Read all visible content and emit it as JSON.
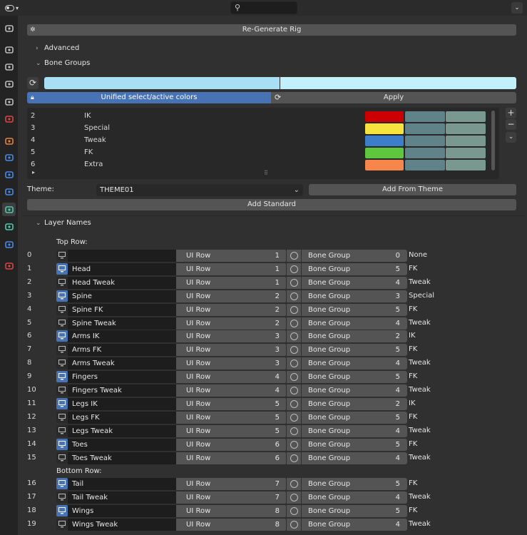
{
  "topbar": {
    "search_placeholder": ""
  },
  "panel": {
    "regenerate_label": "Re-Generate Rig",
    "advanced_label": "Advanced",
    "bone_groups_label": "Bone Groups",
    "unified_label": "Unified select/active colors",
    "apply_label": "Apply",
    "theme_label": "Theme:",
    "theme_value": "THEME01",
    "add_from_theme_label": "Add From Theme",
    "add_standard_label": "Add Standard",
    "layer_names_label": "Layer Names",
    "top_row_label": "Top Row:",
    "bottom_row_label": "Bottom Row:",
    "ui_row_label": "UI Row",
    "bone_group_label": "Bone Group",
    "colors": {
      "accent": "#4772b3",
      "active_swatch": "#a8dff4",
      "select_swatch": "#c2f0fa"
    }
  },
  "bone_groups": [
    {
      "num": "2",
      "name": "IK",
      "color": "#cc0000"
    },
    {
      "num": "3",
      "name": "Special",
      "color": "#f7e33d"
    },
    {
      "num": "4",
      "name": "Tweak",
      "color": "#3d7ecb"
    },
    {
      "num": "5",
      "name": "FK",
      "color": "#5fc73d"
    },
    {
      "num": "6",
      "name": "Extra",
      "color": "#f7864d"
    }
  ],
  "layers": [
    {
      "idx": "0",
      "name": "",
      "on": false,
      "row": "1",
      "group": "0",
      "gname": "None"
    },
    {
      "idx": "1",
      "name": " Head",
      "on": true,
      "row": "1",
      "group": "5",
      "gname": "FK"
    },
    {
      "idx": "2",
      "name": "Head Tweak",
      "on": false,
      "row": "1",
      "group": "4",
      "gname": "Tweak"
    },
    {
      "idx": "3",
      "name": "Spine",
      "on": true,
      "row": "2",
      "group": "3",
      "gname": "Special"
    },
    {
      "idx": "4",
      "name": "Spine FK",
      "on": false,
      "row": "2",
      "group": "5",
      "gname": "FK"
    },
    {
      "idx": "5",
      "name": "Spine Tweak",
      "on": false,
      "row": "2",
      "group": "4",
      "gname": "Tweak"
    },
    {
      "idx": "6",
      "name": "Arms IK",
      "on": true,
      "row": "3",
      "group": "2",
      "gname": "IK"
    },
    {
      "idx": "7",
      "name": "Arms FK",
      "on": false,
      "row": "3",
      "group": "5",
      "gname": "FK"
    },
    {
      "idx": "8",
      "name": "Arms Tweak",
      "on": false,
      "row": "3",
      "group": "4",
      "gname": "Tweak"
    },
    {
      "idx": "9",
      "name": "Fingers",
      "on": true,
      "row": "4",
      "group": "5",
      "gname": "FK"
    },
    {
      "idx": "10",
      "name": "Fingers Tweak",
      "on": false,
      "row": "4",
      "group": "4",
      "gname": "Tweak"
    },
    {
      "idx": "11",
      "name": "Legs IK",
      "on": true,
      "row": "5",
      "group": "2",
      "gname": "IK"
    },
    {
      "idx": "12",
      "name": "Legs FK",
      "on": false,
      "row": "5",
      "group": "5",
      "gname": "FK"
    },
    {
      "idx": "13",
      "name": "Legs Tweak",
      "on": false,
      "row": "5",
      "group": "4",
      "gname": "Tweak"
    },
    {
      "idx": "14",
      "name": "Toes",
      "on": true,
      "row": "6",
      "group": "5",
      "gname": "FK"
    },
    {
      "idx": "15",
      "name": "Toes Tweak",
      "on": false,
      "row": "6",
      "group": "4",
      "gname": "Tweak"
    }
  ],
  "bottom_layers": [
    {
      "idx": "16",
      "name": "Tail",
      "on": true,
      "row": "7",
      "group": "5",
      "gname": "FK"
    },
    {
      "idx": "17",
      "name": "Tail Tweak",
      "on": false,
      "row": "7",
      "group": "4",
      "gname": "Tweak"
    },
    {
      "idx": "18",
      "name": "Wings",
      "on": true,
      "row": "8",
      "group": "5",
      "gname": "FK"
    },
    {
      "idx": "19",
      "name": "Wings Tweak",
      "on": false,
      "row": "8",
      "group": "4",
      "gname": "Tweak"
    }
  ],
  "tab_icons": [
    "tool-icon",
    "render-icon",
    "output-icon",
    "view-layer-icon",
    "scene-icon",
    "world-icon",
    "object-icon",
    "modifiers-icon",
    "particles-icon",
    "physics-icon",
    "object-data-armature-icon",
    "bone-icon",
    "bone-constraints-icon",
    "texture-icon"
  ]
}
